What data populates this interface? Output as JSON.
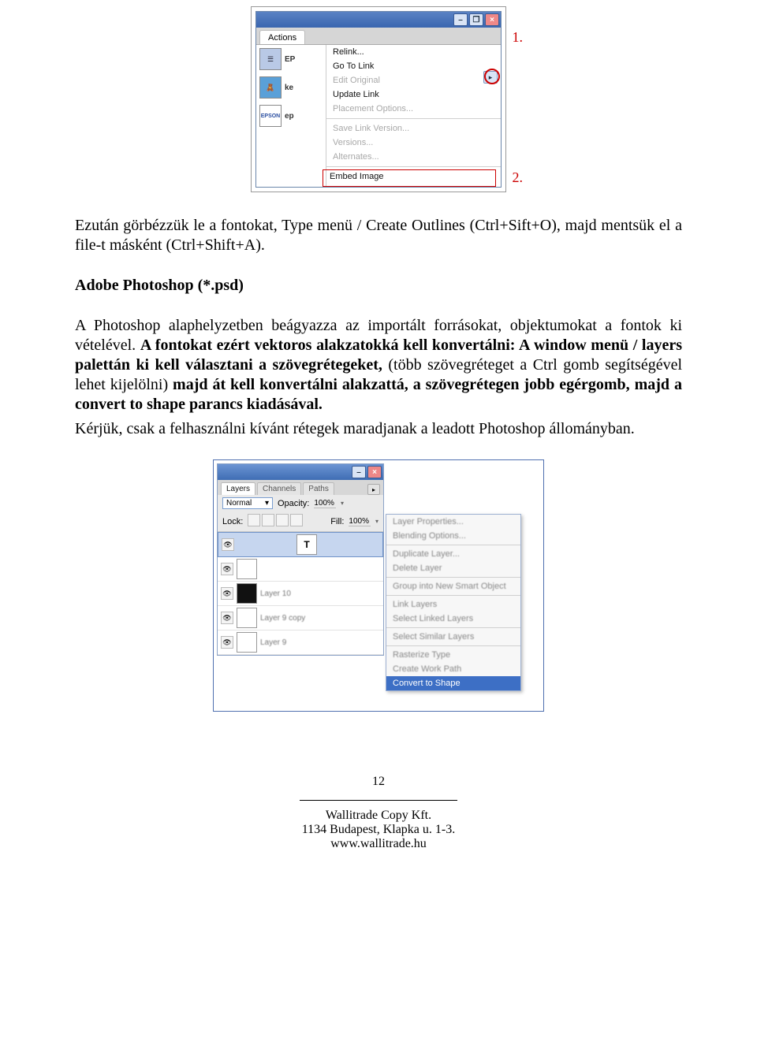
{
  "indesign_panel": {
    "titlebar": {
      "min": "–",
      "restore": "❐",
      "close": "×"
    },
    "tabs": {
      "actions": "Actions"
    },
    "flyout_glyph": "▸",
    "thumbs": [
      {
        "label": "EP"
      },
      {
        "label": "ke"
      },
      {
        "label": "ep"
      }
    ],
    "menu": [
      {
        "label": "Relink...",
        "disabled": false
      },
      {
        "label": "Go To Link",
        "disabled": false
      },
      {
        "label": "Edit Original",
        "disabled": true
      },
      {
        "label": "Update Link",
        "disabled": false
      },
      {
        "label": "Placement Options...",
        "disabled": true
      },
      {
        "sep": true
      },
      {
        "label": "Save Link Version...",
        "disabled": true
      },
      {
        "label": "Versions...",
        "disabled": true
      },
      {
        "label": "Alternates...",
        "disabled": true
      },
      {
        "sep": true
      },
      {
        "label": "Embed Image",
        "disabled": false
      }
    ],
    "callouts": {
      "one": "1.",
      "two": "2."
    }
  },
  "body": {
    "p1": "Ezután görbézzük le a fontokat, Type menü / Create Outlines (Ctrl+Sift+O), majd mentsük el a file-t másként (Ctrl+Shift+A).",
    "h1": "Adobe Photoshop (*.psd)",
    "p2a": "A Photoshop alaphelyzetben beágyazza az importált forrásokat, objektumokat a fontok ki vételével. ",
    "p2b": "A fontokat ezért vektoros alakzatokká kell konvertálni: A window menü / layers palettán ki kell választani a szövegrétegeket, ",
    "p2c": "(több szövegréteget a Ctrl gomb segítségével lehet kijelölni)",
    "p2d": " majd át kell konvertálni alakzattá, a szövegrétegen jobb egérgomb, majd a convert to shape parancs kiadásával.",
    "p3": "Kérjük, csak a felhasználni kívánt rétegek maradjanak a leadott Photoshop állományban."
  },
  "ps_panel": {
    "titlebar": {
      "min": "–",
      "close": "×"
    },
    "tabs": [
      "Layers",
      "Channels",
      "Paths"
    ],
    "flyout_glyph": "▸",
    "mode_label": "Normal",
    "dropdown_glyph": "▾",
    "opacity_label": "Opacity:",
    "opacity_value": "100%",
    "lock_label": "Lock:",
    "fill_label": "Fill:",
    "fill_value": "100%",
    "eye_glyph": "👁",
    "type_glyph": "T",
    "layers": [
      {
        "type": "T",
        "name": "",
        "selected": true
      },
      {
        "thumb": "light",
        "name": ""
      },
      {
        "thumb": "dark",
        "name": "Layer 10"
      },
      {
        "thumb": "light",
        "name": "Layer 9 copy"
      },
      {
        "thumb": "light",
        "name": "Layer 9"
      }
    ],
    "context_menu": [
      "Layer Properties...",
      "Blending Options...",
      "__sep__",
      "Duplicate Layer...",
      "Delete Layer",
      "__sep__",
      "Group into New Smart Object",
      "__sep__",
      "Link Layers",
      "Select Linked Layers",
      "__sep__",
      "Select Similar Layers",
      "__sep__",
      "Rasterize Type",
      "Create Work Path",
      "__hl__Convert to Shape"
    ]
  },
  "footer": {
    "page": "12",
    "line1": "Wallitrade Copy Kft.",
    "line2": "1134 Budapest, Klapka u. 1-3.",
    "line3": "www.wallitrade.hu"
  }
}
